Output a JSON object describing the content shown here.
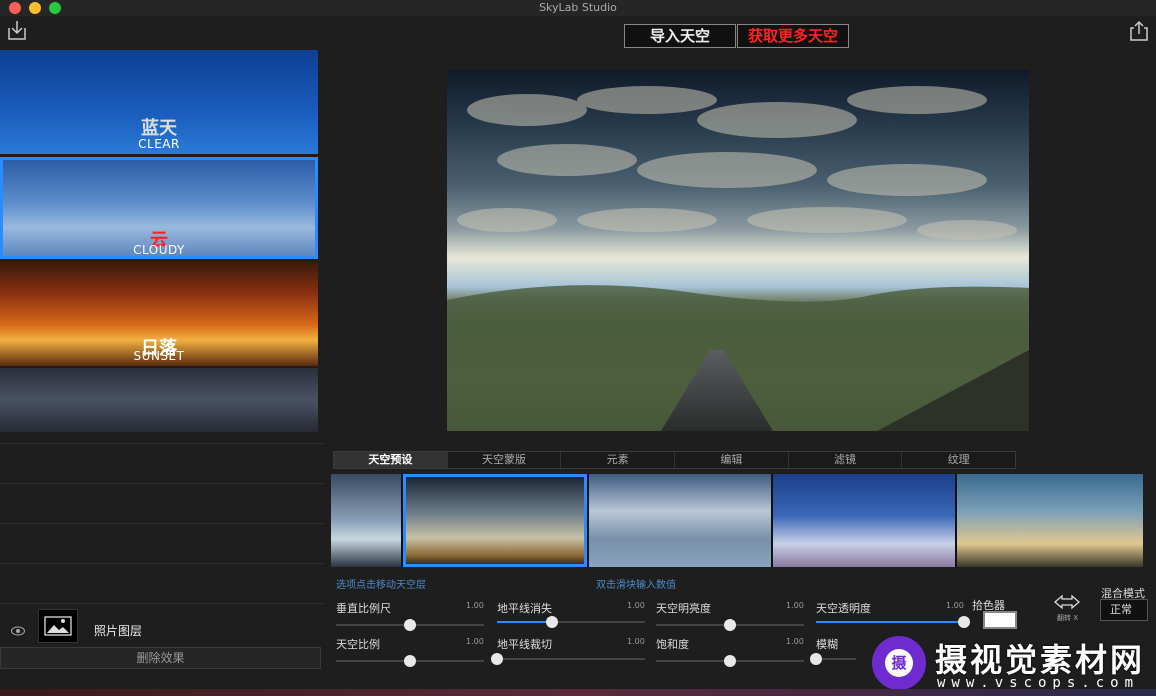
{
  "window": {
    "title": "SkyLab Studio"
  },
  "toolbar": {
    "import_label": "导入天空",
    "more_label": "获取更多天空"
  },
  "presets": [
    {
      "name_cn": "蓝天",
      "name_en": "CLEAR",
      "cn_color": "#111111"
    },
    {
      "name_cn": "云",
      "name_en": "CLOUDY",
      "cn_color": "#ff2222"
    },
    {
      "name_cn": "日落",
      "name_en": "SUNSET",
      "cn_color": "#ffffff"
    },
    {
      "name_cn": "",
      "name_en": ""
    }
  ],
  "layer": {
    "name": "照片图层"
  },
  "delete_effect_label": "删除效果",
  "tabs": [
    "天空预设",
    "天空蒙版",
    "元素",
    "编辑",
    "滤镜",
    "纹理"
  ],
  "active_tab": "天空预设",
  "hints": {
    "left": "选项点击移动天空层",
    "right": "双击滑块输入数值"
  },
  "sliders": [
    {
      "label": "垂直比例尺",
      "value": "1.00",
      "level": 0.5
    },
    {
      "label": "天空比例",
      "value": "1.00",
      "level": 0.5
    },
    {
      "label": "地平线消失",
      "value": "1.00",
      "level": 0.37
    },
    {
      "label": "地平线裁切",
      "value": "1.00",
      "level": 0.0
    },
    {
      "label": "天空明亮度",
      "value": "1.00",
      "level": 0.5
    },
    {
      "label": "饱和度",
      "value": "1.00",
      "level": 0.5
    },
    {
      "label": "天空透明度",
      "value": "1.00",
      "level": 1.0
    },
    {
      "label": "模糊",
      "value": "",
      "level": 0.0
    }
  ],
  "picker": {
    "label": "拾色器",
    "color": "#ffffff"
  },
  "flip": {
    "label": "翻转 X"
  },
  "blend": {
    "label": "混合模式",
    "value": "正常"
  },
  "watermark": {
    "title": "摄视觉素材网",
    "sub": "www.vscops.com",
    "badge": "摄"
  },
  "colors": {
    "accent": "#2a8cff",
    "more_sky": "#ff2222"
  }
}
